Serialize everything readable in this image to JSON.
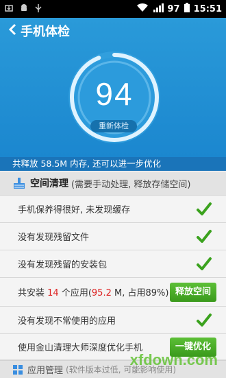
{
  "status_bar": {
    "battery_percent": "97",
    "time": "15:51",
    "icons": [
      "download-icon",
      "android-icon",
      "usb-icon",
      "wifi-icon",
      "signal-icon",
      "battery-icon"
    ]
  },
  "nav": {
    "title": "手机体检"
  },
  "score": {
    "value": "94",
    "recheck_label": "重新体检",
    "gauge_fraction": 0.94
  },
  "summary": "共释放 58.5M 内存, 还可以进一步优化",
  "section": {
    "title": "空间清理",
    "subtitle": "(需要手动处理, 释放存储空间)"
  },
  "items": [
    {
      "text": "手机保养得很好, 未发现缓存"
    },
    {
      "text": "没有发现残留文件"
    },
    {
      "text": "没有发现残留的安装包"
    },
    {
      "text_a": "共安装 ",
      "apps": "14",
      "text_b": " 个应用(",
      "size": "95.2",
      "text_c": " M, 占用89%)",
      "button": "释放空间"
    },
    {
      "text": "没有发现不常使用的应用"
    },
    {
      "text": "使用金山清理大师深度优化手机",
      "button": "一键优化"
    }
  ],
  "bottom": {
    "title": "应用管理",
    "subtitle": "(软件版本过低, 可能影响使用)"
  },
  "watermark": "xfdown.com",
  "colors": {
    "header_blue": "#2a9ad9",
    "summary_blue": "#1a74b9",
    "check_green": "#3ba21e",
    "button_green": "#4cae2a"
  }
}
